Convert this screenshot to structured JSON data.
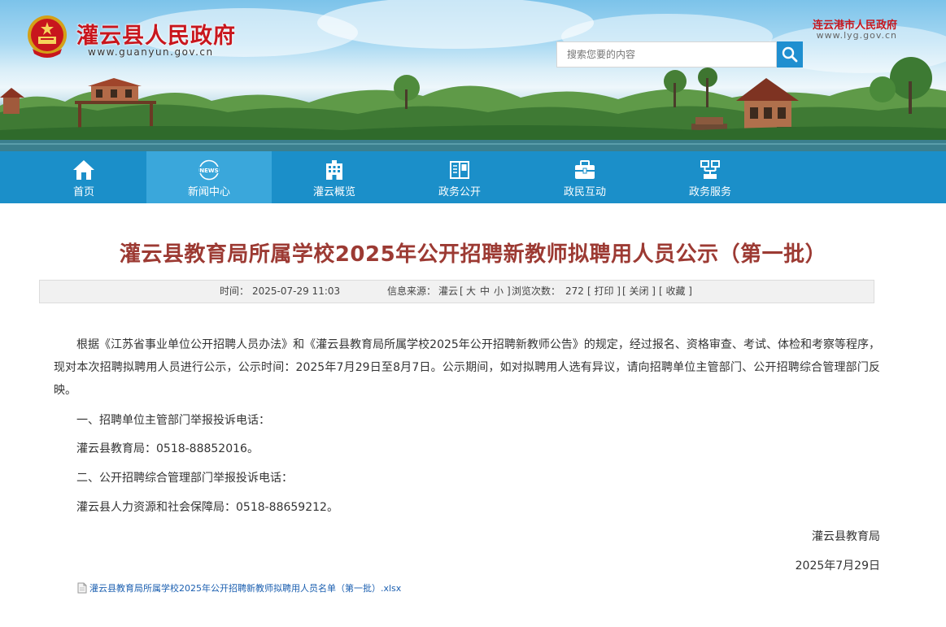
{
  "header": {
    "site_title": "灌云县人民政府",
    "site_url": "www.guanyun.gov.cn",
    "city_site_title": "连云港市人民政府",
    "city_site_url": "www.lyg.gov.cn",
    "search": {
      "placeholder": "搜索您要的内容"
    }
  },
  "nav": {
    "items": [
      {
        "label": "首页",
        "icon": "home-icon"
      },
      {
        "label": "新闻中心",
        "icon": "news-icon",
        "active": true
      },
      {
        "label": "灌云概览",
        "icon": "building-icon"
      },
      {
        "label": "政务公开",
        "icon": "book-icon"
      },
      {
        "label": "政民互动",
        "icon": "briefcase-icon"
      },
      {
        "label": "政务服务",
        "icon": "service-icon"
      }
    ]
  },
  "article": {
    "title": "灌云县教育局所属学校2025年公开招聘新教师拟聘用人员公示（第一批）",
    "meta": {
      "time_label": "时间：",
      "time_value": "2025-07-29 11:03",
      "source_label": "信息来源：",
      "source_value": "灌云",
      "font_open": "[",
      "font_large": "大",
      "font_medium": "中",
      "font_small": "小",
      "font_close": "]",
      "views_label": "浏览次数：",
      "views_value": "272",
      "print": "[ 打印 ]",
      "close": "[ 关闭 ]",
      "favorite": "[ 收藏 ]"
    },
    "paragraph1": "根据《江苏省事业单位公开招聘人员办法》和《灌云县教育局所属学校2025年公开招聘新教师公告》的规定，经过报名、资格审查、考试、体检和考察等程序，现对本次招聘拟聘用人员进行公示，公示时间：2025年7月29日至8月7日。公示期间，如对拟聘用人选有异议，请向招聘单位主管部门、公开招聘综合管理部门反映。",
    "line1": "一、招聘单位主管部门举报投诉电话：",
    "line2": "灌云县教育局：0518-88852016。",
    "line3": "二、公开招聘综合管理部门举报投诉电话：",
    "line4": "灌云县人力资源和社会保障局：0518-88659212。",
    "signature_org": "灌云县教育局",
    "signature_date": "2025年7月29日",
    "attachment": "灌云县教育局所属学校2025年公开招聘新教师拟聘用人员名单（第一批）.xlsx"
  },
  "colors": {
    "nav_bg": "#1b8fc9",
    "nav_active": "#3aa7db",
    "title_red": "#c8161d",
    "article_title": "#9c3a33",
    "link_blue": "#1b5fb0"
  }
}
